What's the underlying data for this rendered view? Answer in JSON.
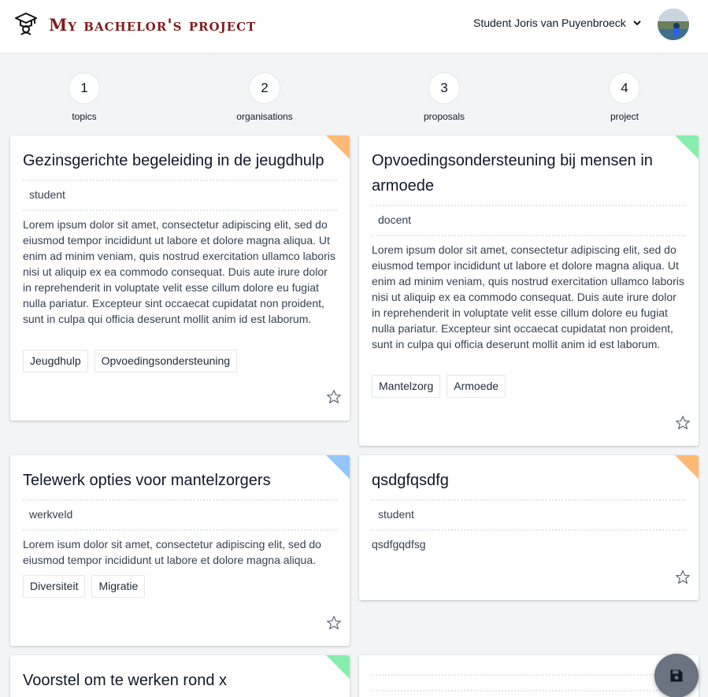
{
  "header": {
    "app_title": "My bachelor's project",
    "user_name": "Student Joris van Puyenbroeck",
    "logo_icon": "graduation-cap-icon",
    "menu_icon": "chevron-down-icon"
  },
  "steps": [
    {
      "number": "1",
      "label": "topics"
    },
    {
      "number": "2",
      "label": "organisations"
    },
    {
      "number": "3",
      "label": "proposals"
    },
    {
      "number": "4",
      "label": "project"
    }
  ],
  "colors": {
    "orange": "#fdba74",
    "green": "#86efac",
    "blue": "#93c5fd",
    "title_red": "#7f1d1d"
  },
  "cards": [
    {
      "title": "Gezinsgerichte begeleiding in de jeugdhulp",
      "role": "student",
      "description": "Lorem ipsum dolor sit amet, consectetur adipiscing elit, sed do eiusmod tempor incididunt ut labore et dolore magna aliqua. Ut enim ad minim veniam, quis nostrud exercitation ullamco laboris nisi ut aliquip ex ea commodo consequat. Duis aute irure dolor in reprehenderit in voluptate velit esse cillum dolore eu fugiat nulla pariatur. Excepteur sint occaecat cupidatat non proident, sunt in culpa qui officia deserunt mollit anim id est laborum.",
      "tags": [
        "Jeugdhulp",
        "Opvoedingsondersteuning"
      ],
      "corner_color": "#fdba74"
    },
    {
      "title": "Opvoedingsondersteuning bij mensen in armoede",
      "role": "docent",
      "description": "Lorem ipsum dolor sit amet, consectetur adipiscing elit, sed do eiusmod tempor incididunt ut labore et dolore magna aliqua. Ut enim ad minim veniam, quis nostrud exercitation ullamco laboris nisi ut aliquip ex ea commodo consequat. Duis aute irure dolor in reprehenderit in voluptate velit esse cillum dolore eu fugiat nulla pariatur. Excepteur sint occaecat cupidatat non proident, sunt in culpa qui officia deserunt mollit anim id est laborum.",
      "tags": [
        "Mantelzorg",
        "Armoede"
      ],
      "corner_color": "#86efac"
    },
    {
      "title": "Telewerk opties voor mantelzorgers",
      "role": "werkveld",
      "description": "Lorem isum dolor sit amet, consectetur adipiscing elit, sed do eiusmod tempor incididunt ut labore et dolore magna aliqua.",
      "tags": [
        "Diversiteit",
        "Migratie"
      ],
      "corner_color": "#93c5fd"
    },
    {
      "title": "qsdgfqsdfg",
      "role": "student",
      "description": "qsdfgqdfsg",
      "tags": [],
      "corner_color": "#fdba74"
    },
    {
      "title": "Voorstel om te werken rond x",
      "role": "",
      "description": "",
      "tags": [],
      "corner_color": "#86efac"
    }
  ],
  "fab": {
    "icon": "save-icon"
  }
}
